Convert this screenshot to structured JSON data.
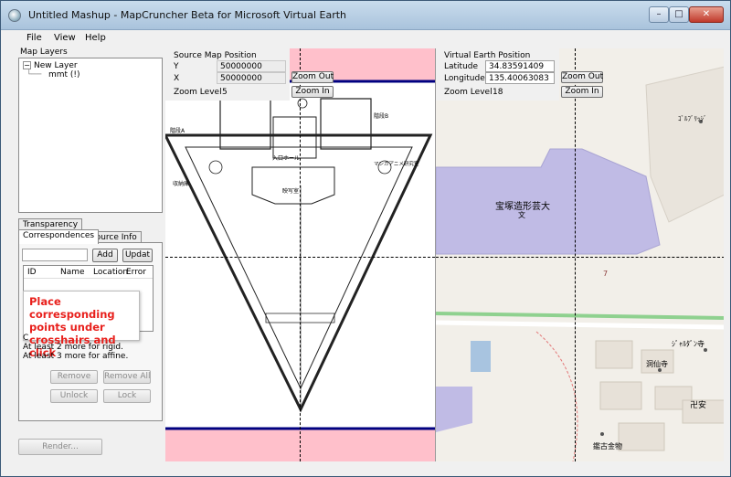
{
  "window": {
    "title": "Untitled Mashup - MapCruncher Beta for Microsoft Virtual Earth",
    "min_glyph": "–",
    "max_glyph": "□",
    "close_glyph": "✕"
  },
  "menu": [
    "File",
    "View",
    "Help"
  ],
  "layers": {
    "header": "Map Layers",
    "expander_glyph": "−",
    "root_label": "New Layer",
    "child_label": "mmt (!)"
  },
  "tabs": {
    "transparency": "Transparency",
    "correspondences": "Correspondences",
    "source_info": "Source Info"
  },
  "correspondences": {
    "input_value": "",
    "add_label": "Add",
    "update_label": "Updat",
    "columns": [
      "ID",
      "Name",
      "Location",
      "Error"
    ],
    "tooltip": "Place corresponding points under crosshairs and click",
    "status_c": "C",
    "status_rigid": "At least 2 more for rigid.",
    "status_affine": "At least 3 more for affine.",
    "remove_label": "Remove",
    "remove_all_label": "Remove All",
    "unlock_label": "Unlock",
    "lock_label": "Lock"
  },
  "render_label": "Render...",
  "source_map": {
    "header": "Source Map Position",
    "y_label": "Y",
    "y_value": "50000000",
    "x_label": "X",
    "x_value": "50000000",
    "zoom_level_label": "Zoom Level",
    "zoom_level_value": "5",
    "zoom_out_label": "Zoom Out",
    "zoom_in_label": "Zoom In",
    "plan_labels": {
      "stair_a": "階段A",
      "stair_b": "階段B",
      "entrance_hall": "入口ホール",
      "wc": "WC",
      "storage": "収納庫",
      "photo_room": "映写室",
      "manga_lab": "マンガアニメ研究室"
    }
  },
  "virtual_earth": {
    "header": "Virtual Earth Position",
    "latitude_label": "Latitude",
    "latitude_value": "34.83591409",
    "longitude_label": "Longitude",
    "longitude_value": "135.40063083",
    "zoom_level_label": "Zoom Level",
    "zoom_level_value": "18",
    "zoom_out_label": "Zoom Out",
    "zoom_in_label": "Zoom In",
    "map_labels": {
      "university": "宝塚造形芸大",
      "university_symbol": "文",
      "block_number": "7",
      "top_right": "ｺﾞﾙﾌﾞﾘｯｼﾞ",
      "temple": "ｼﾞｬﾙﾀﾞﾝ寺",
      "monastery": "洞仙寺",
      "shrine_text": "卍安",
      "cultural": "鑑古金物"
    }
  },
  "colors": {
    "window_bg": "#f0f0f0",
    "titlebar": "#b9cfe4",
    "university_area": "#c0bbe5",
    "map_bg": "#f2efe9",
    "road_green": "#8fd18f",
    "water": "#a8c4e0",
    "pink_band": "#ffc0cb",
    "navy_line": "#000080",
    "callout_text": "#e8201c"
  },
  "icons": [
    "app-icon",
    "minimize-icon",
    "maximize-icon",
    "close-icon",
    "tree-expander-icon"
  ]
}
